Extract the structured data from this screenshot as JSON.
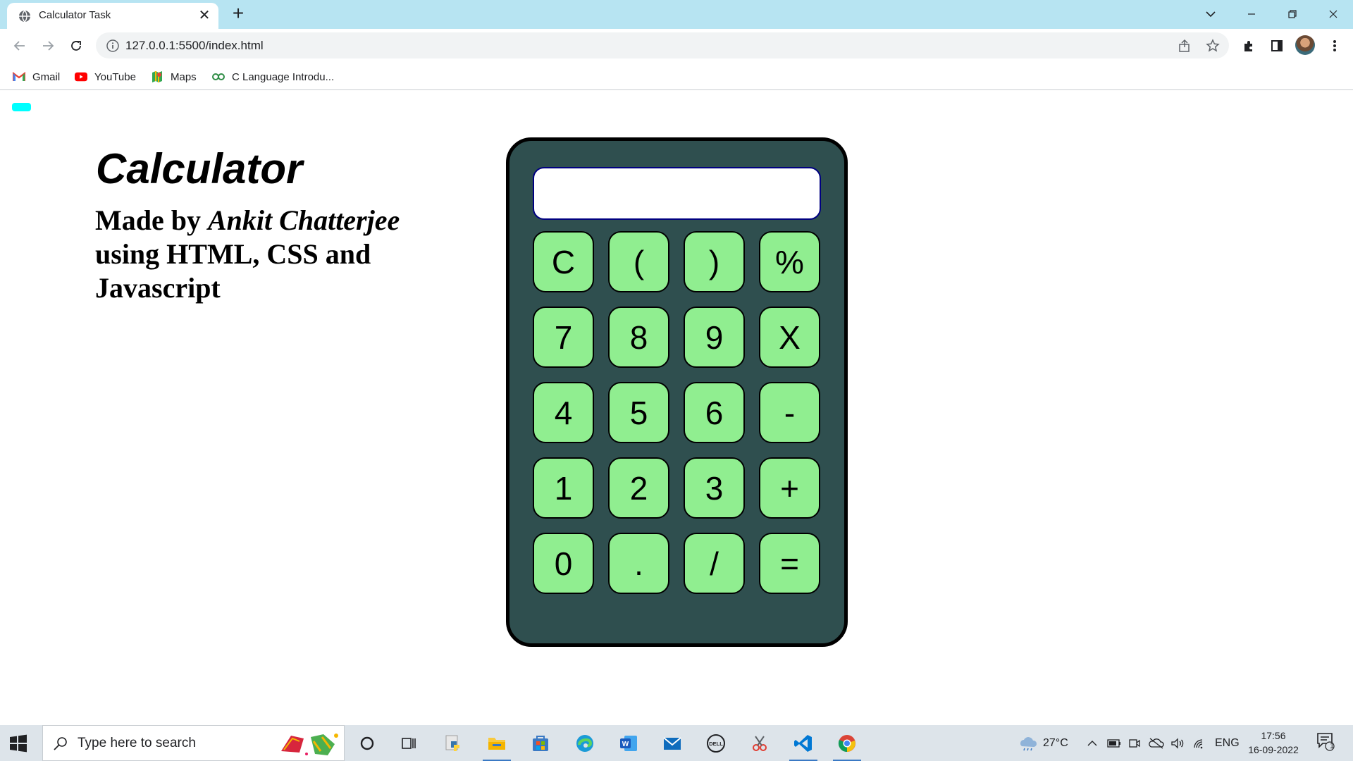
{
  "browser": {
    "tab": {
      "title": "Calculator Task"
    },
    "url": "127.0.0.1:5500/index.html",
    "bookmarks": [
      {
        "label": "Gmail",
        "icon": "gmail-icon"
      },
      {
        "label": "YouTube",
        "icon": "youtube-icon"
      },
      {
        "label": "Maps",
        "icon": "maps-icon"
      },
      {
        "label": "C Language Introdu...",
        "icon": "gfg-icon"
      }
    ]
  },
  "page": {
    "heading": "Calculator",
    "madeby_prefix": "Made by ",
    "author": "Ankit Chatterjee",
    "madeby_suffix": " using HTML, CSS and Javascript",
    "display_value": "",
    "keys": [
      "C",
      "(",
      ")",
      "%",
      "7",
      "8",
      "9",
      "X",
      "4",
      "5",
      "6",
      "-",
      "1",
      "2",
      "3",
      "+",
      "0",
      ".",
      "/",
      "="
    ],
    "colors": {
      "body": "#2f4f4f",
      "key": "#90ee90",
      "display_border": "#000080",
      "accent_bar": "#00ffff"
    }
  },
  "taskbar": {
    "search_placeholder": "Type here to search",
    "weather": "27°C",
    "language": "ENG",
    "time": "17:56",
    "date": "16-09-2022",
    "notifications_count": "1"
  }
}
